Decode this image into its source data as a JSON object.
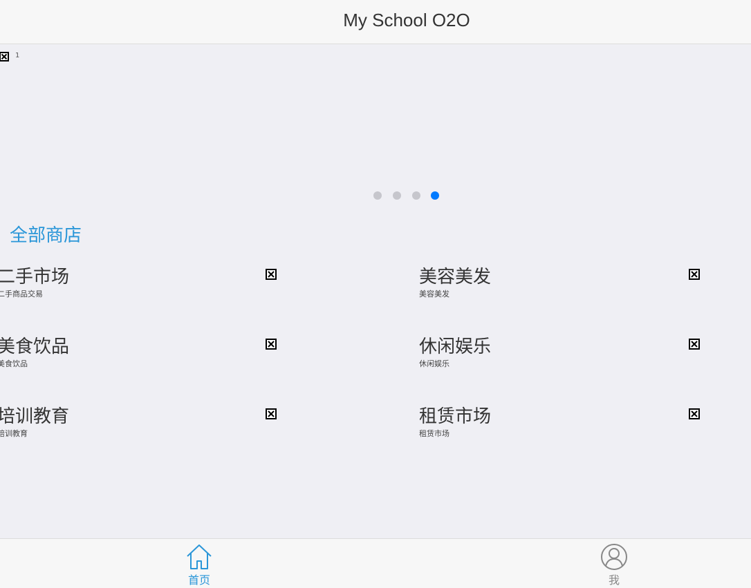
{
  "header": {
    "title": "My School O2O"
  },
  "slider": {
    "current_index_label": "1",
    "image_icon": "broken-image-icon",
    "dot_count": 4,
    "active_dot": 4,
    "active_color": "#007aff",
    "dot_color": "#c6c6cc"
  },
  "section": {
    "title": "全部商店",
    "title_color": "#2a96d8"
  },
  "shops": [
    {
      "name": "二手市场",
      "desc": "二手商品交易",
      "icon": "broken-image-icon"
    },
    {
      "name": "美容美发",
      "desc": "美容美发",
      "icon": "broken-image-icon"
    },
    {
      "name": "美食饮品",
      "desc": "美食饮品",
      "icon": "broken-image-icon"
    },
    {
      "name": "休闲娱乐",
      "desc": "休闲娱乐",
      "icon": "broken-image-icon"
    },
    {
      "name": "培训教育",
      "desc": "培训教育",
      "icon": "broken-image-icon"
    },
    {
      "name": "租赁市场",
      "desc": "租赁市场",
      "icon": "broken-image-icon"
    }
  ],
  "tabbar": {
    "home": {
      "label": "首页",
      "icon": "home-icon",
      "active": true
    },
    "me": {
      "label": "我",
      "icon": "user-icon",
      "active": false
    }
  }
}
